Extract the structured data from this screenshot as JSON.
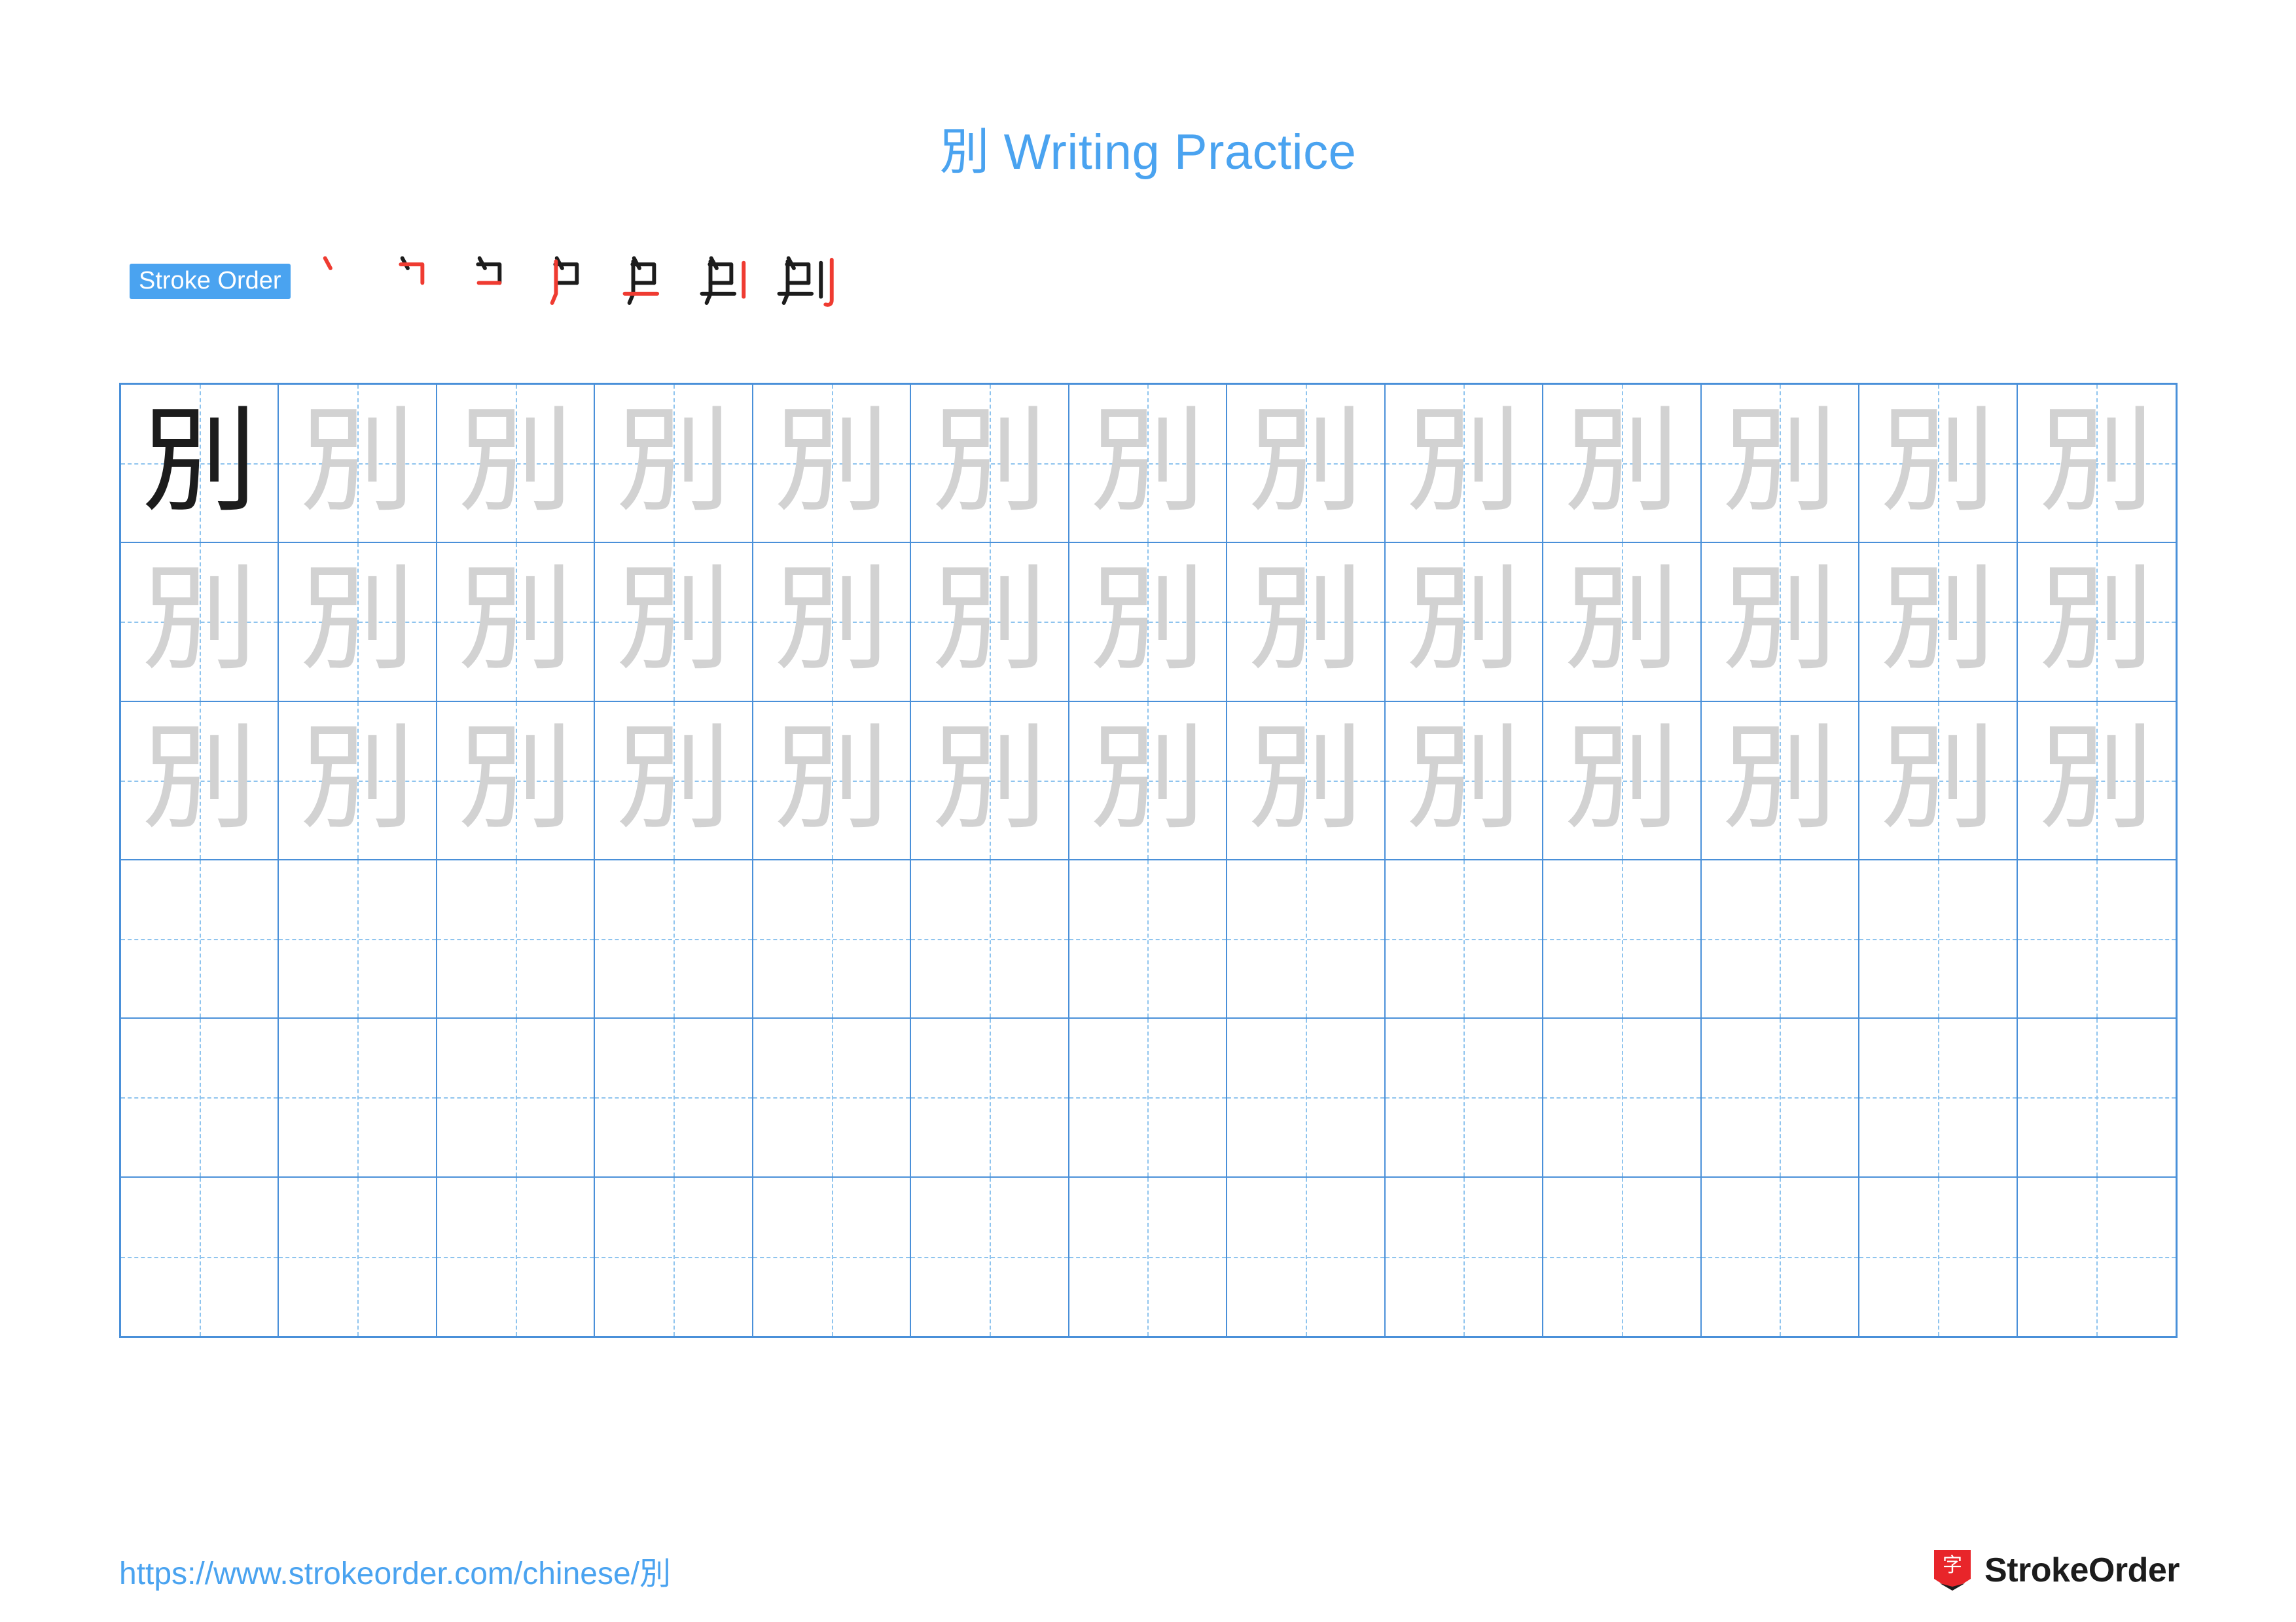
{
  "document": {
    "character": "別",
    "title": "別 Writing Practice",
    "title_color": "#4aa3f0"
  },
  "stroke_order": {
    "label": "Stroke Order",
    "badge_bg": "#4aa3f0",
    "badge_text_color": "#ffffff",
    "new_stroke_color": "#ef3b31",
    "existing_stroke_color": "#1c1c1c",
    "steps": [
      {
        "index": 1,
        "partial": "丶"
      },
      {
        "index": 2,
        "partial": "冂"
      },
      {
        "index": 3,
        "partial": "口"
      },
      {
        "index": 4,
        "partial": "尸"
      },
      {
        "index": 5,
        "partial": "号"
      },
      {
        "index": 6,
        "partial": "别"
      },
      {
        "index": 7,
        "partial": "別"
      }
    ]
  },
  "practice_grid": {
    "columns": 13,
    "rows": 6,
    "border_color": "#4a90d9",
    "guide_color": "#8fc4ee",
    "trace_color": "#d2d2d2",
    "solid_color": "#1c1c1c",
    "cells": [
      [
        "別-solid",
        "別-trace",
        "別-trace",
        "別-trace",
        "別-trace",
        "別-trace",
        "別-trace",
        "別-trace",
        "別-trace",
        "別-trace",
        "別-trace",
        "別-trace",
        "別-trace"
      ],
      [
        "別-trace",
        "別-trace",
        "別-trace",
        "別-trace",
        "別-trace",
        "別-trace",
        "別-trace",
        "別-trace",
        "別-trace",
        "別-trace",
        "別-trace",
        "別-trace",
        "別-trace"
      ],
      [
        "別-trace",
        "別-trace",
        "別-trace",
        "別-trace",
        "別-trace",
        "別-trace",
        "別-trace",
        "別-trace",
        "別-trace",
        "別-trace",
        "別-trace",
        "別-trace",
        "別-trace"
      ],
      [
        "",
        "",
        "",
        "",
        "",
        "",
        "",
        "",
        "",
        "",
        "",
        "",
        ""
      ],
      [
        "",
        "",
        "",
        "",
        "",
        "",
        "",
        "",
        "",
        "",
        "",
        "",
        ""
      ],
      [
        "",
        "",
        "",
        "",
        "",
        "",
        "",
        "",
        "",
        "",
        "",
        "",
        ""
      ]
    ]
  },
  "footer": {
    "url": "https://www.strokeorder.com/chinese/別",
    "url_color": "#4aa3f0",
    "brand_name": "StrokeOrder",
    "brand_logo_glyph": "字",
    "brand_logo_color": "#e8252a"
  }
}
